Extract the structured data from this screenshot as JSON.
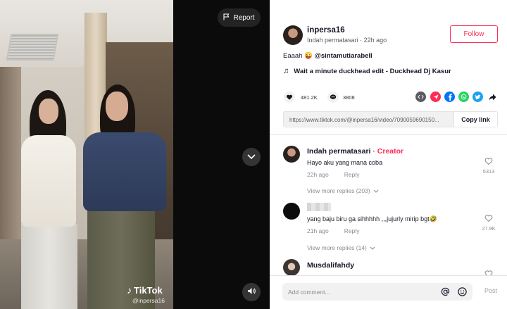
{
  "video": {
    "watermark_brand": "TikTok",
    "watermark_handle": "@inpersa16",
    "report_label": "Report"
  },
  "author": {
    "handle": "inpersa16",
    "display_name": "Indah permatasari",
    "time_ago": "22h ago",
    "follow_label": "Follow"
  },
  "caption": {
    "text": "Eaaah 😜 ",
    "mention": "@sintamutiarabell"
  },
  "music": {
    "title": "Wait a minute duckhead edit - Duckhead Dj Kasur"
  },
  "stats": {
    "likes": "481.2K",
    "comments": "3808"
  },
  "share_icons": [
    "embed-icon",
    "send-icon",
    "facebook-icon",
    "whatsapp-icon",
    "twitter-icon",
    "share-arrow-icon"
  ],
  "share_colors": {
    "embed": "#5b5b63",
    "send": "#fe2c55",
    "facebook": "#0075fa",
    "whatsapp": "#25d366",
    "twitter": "#1da1f2"
  },
  "link": {
    "url": "https://www.tiktok.com/@inpersa16/video/7090059690150...",
    "copy_label": "Copy link"
  },
  "comments": [
    {
      "author": "Indah permatasari",
      "badge": "Creator",
      "text": "Hayo aku yang mana coba",
      "time": "22h ago",
      "reply_label": "Reply",
      "likes": "5313",
      "view_more": "View more replies (203)"
    },
    {
      "author": "",
      "text": "yang baju biru ga sihhhhh ,,,jujurly mirip bgt🤣",
      "time": "21h ago",
      "reply_label": "Reply",
      "likes": "27.9K",
      "view_more": "View more replies (14)"
    },
    {
      "author": "Musdalifahdy"
    }
  ],
  "comment_bar": {
    "placeholder": "Add comment...",
    "post_label": "Post"
  },
  "colors": {
    "accent": "#fe2c55",
    "creator": "#fe2c55"
  }
}
